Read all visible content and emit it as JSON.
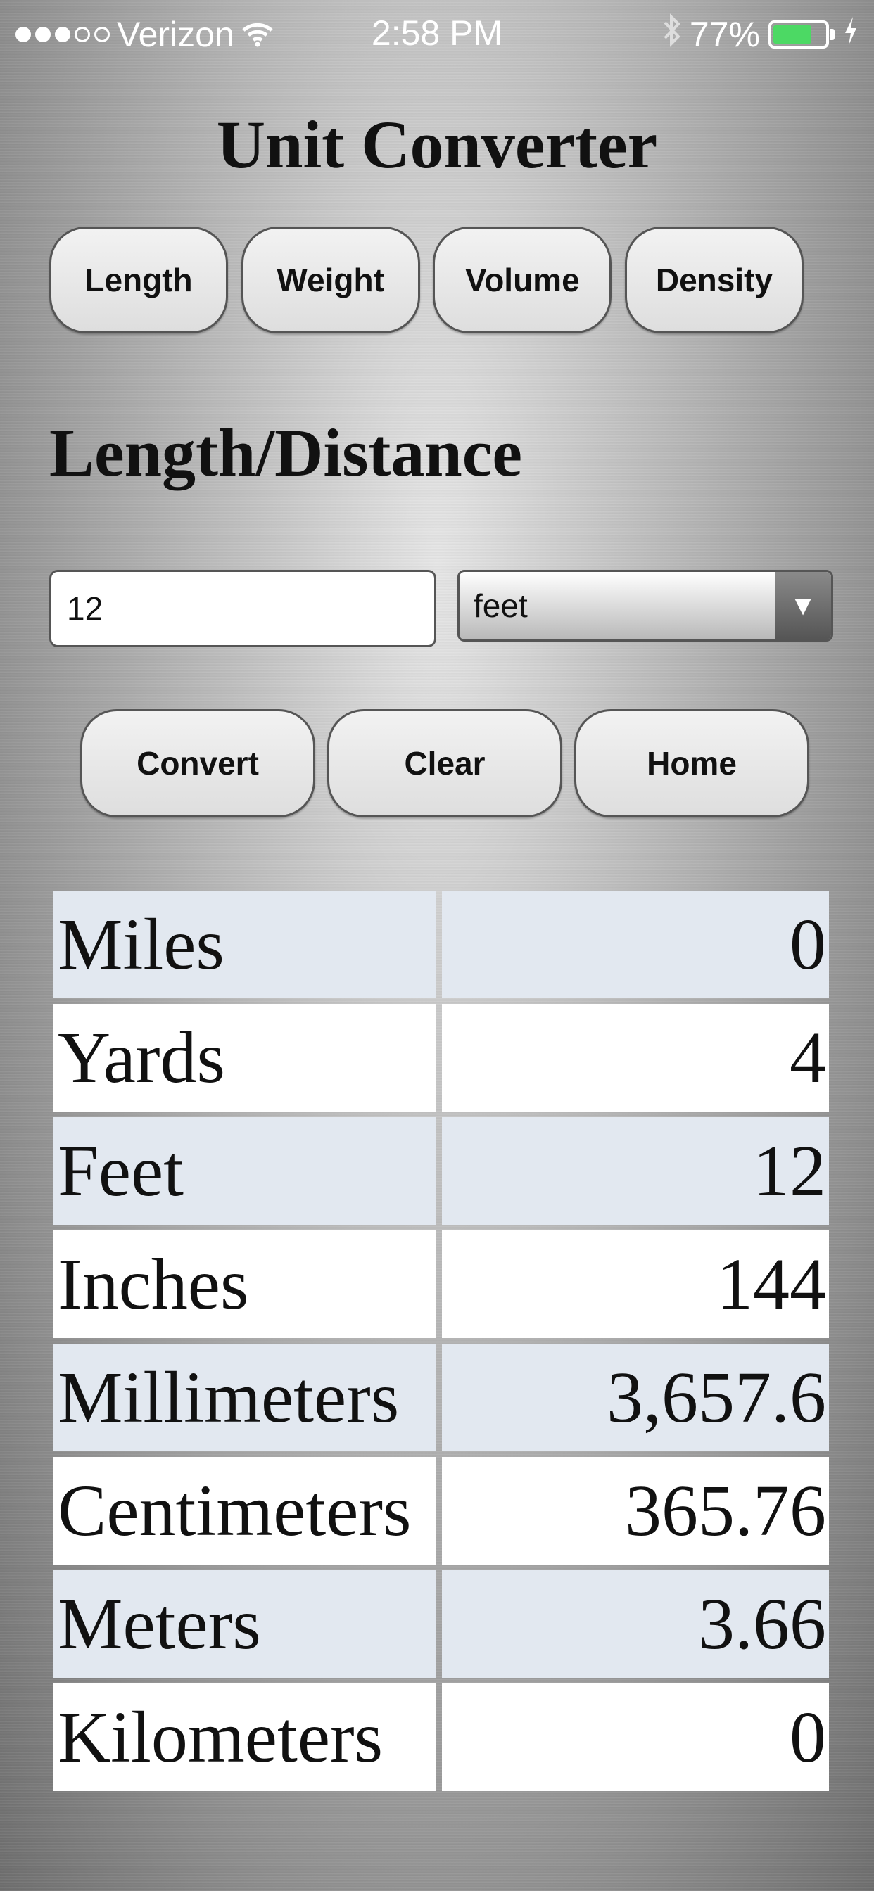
{
  "status_bar": {
    "carrier": "Verizon",
    "time": "2:58 PM",
    "battery_percent": "77%",
    "battery_level": 0.77,
    "battery_color": "#4cd964"
  },
  "app_title": "Unit Converter",
  "categories": [
    {
      "label": "Length"
    },
    {
      "label": "Weight"
    },
    {
      "label": "Volume"
    },
    {
      "label": "Density"
    }
  ],
  "section_title": "Length/Distance",
  "input": {
    "value": "12"
  },
  "unit_select": {
    "selected": "feet",
    "arrow": "▼"
  },
  "actions": {
    "convert": "Convert",
    "clear": "Clear",
    "home": "Home"
  },
  "results": [
    {
      "unit": "Miles",
      "value": "0"
    },
    {
      "unit": "Yards",
      "value": "4"
    },
    {
      "unit": "Feet",
      "value": "12"
    },
    {
      "unit": "Inches",
      "value": "144"
    },
    {
      "unit": "Millimeters",
      "value": "3,657.6"
    },
    {
      "unit": "Centimeters",
      "value": "365.76"
    },
    {
      "unit": "Meters",
      "value": "3.66"
    },
    {
      "unit": "Kilometers",
      "value": "0"
    }
  ],
  "icons": {
    "signal": "signal-dots-icon",
    "wifi": "wifi-icon",
    "bluetooth": "bluetooth-icon",
    "battery": "battery-icon",
    "charging": "charging-bolt-icon",
    "dropdown": "chevron-down-icon"
  }
}
